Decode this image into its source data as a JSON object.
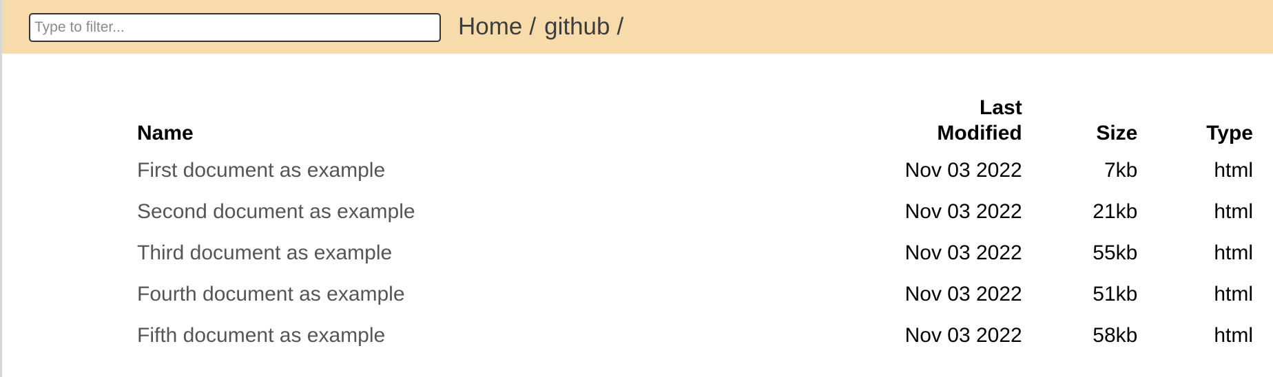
{
  "filter": {
    "placeholder": "Type to filter...",
    "value": ""
  },
  "breadcrumb": [
    {
      "label": "Home",
      "separator": "/"
    },
    {
      "label": "github",
      "separator": "/"
    }
  ],
  "table": {
    "headers": {
      "name": "Name",
      "modified_line1": "Last",
      "modified_line2": "Modified",
      "size": "Size",
      "type": "Type"
    },
    "rows": [
      {
        "name": "First document as example",
        "modified": "Nov 03 2022",
        "size": "7kb",
        "type": "html"
      },
      {
        "name": "Second document as example",
        "modified": "Nov 03 2022",
        "size": "21kb",
        "type": "html"
      },
      {
        "name": "Third document as example",
        "modified": "Nov 03 2022",
        "size": "55kb",
        "type": "html"
      },
      {
        "name": "Fourth document as example",
        "modified": "Nov 03 2022",
        "size": "51kb",
        "type": "html"
      },
      {
        "name": "Fifth document as example",
        "modified": "Nov 03 2022",
        "size": "58kb",
        "type": "html"
      }
    ]
  },
  "colors": {
    "header_bar": "#f7dbab",
    "link_text": "#555555",
    "breadcrumb_text": "#3d3d3d"
  }
}
